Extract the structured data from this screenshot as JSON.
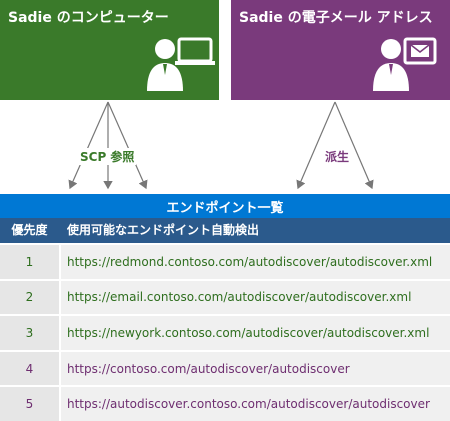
{
  "computer_box": {
    "title": "Sadie のコンピューター",
    "color": "#3a7a2a",
    "icon": "person-at-computer-icon"
  },
  "email_box": {
    "title": "Sadie の電子メール アドレス",
    "color": "#7a3a7c",
    "icon": "person-with-email-icon"
  },
  "arrow_labels": {
    "scp": "SCP 参照",
    "derive": "派生"
  },
  "list": {
    "title": "エンドポイント一覧",
    "title_color": "#0078d4",
    "header_color": "#2b5a8c",
    "col_priority": "優先度",
    "col_url": "使用可能なエンドポイント自動検出",
    "row_color_light": "#f0f0f0",
    "row_color_dark": "#e6e6e6",
    "green_text": "#2e6e1e",
    "purple_text": "#6e2e70",
    "rows": [
      {
        "priority": "1",
        "url": "https://redmond.contoso.com/autodiscover/autodiscover.xml",
        "source": "scp"
      },
      {
        "priority": "2",
        "url": "https://email.contoso.com/autodiscover/autodiscover.xml",
        "source": "scp"
      },
      {
        "priority": "3",
        "url": "https://newyork.contoso.com/autodiscover/autodiscover.xml",
        "source": "scp"
      },
      {
        "priority": "4",
        "url": "https://contoso.com/autodiscover/autodiscover",
        "source": "derived"
      },
      {
        "priority": "5",
        "url": "https://autodiscover.contoso.com/autodiscover/autodiscover",
        "source": "derived"
      }
    ]
  }
}
